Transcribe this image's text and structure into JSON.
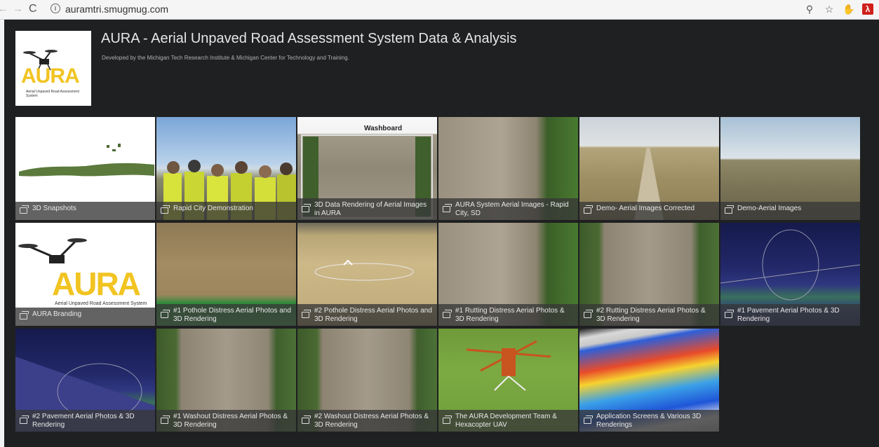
{
  "browser": {
    "url": "auramtri.smugmug.com"
  },
  "header": {
    "title": "AURA - Aerial Unpaved Road Assessment System Data & Analysis",
    "subtitle": "Developed by the Michigan Tech Research Institute & Michigan Center for Technology and Training."
  },
  "logo": {
    "text": "AURA",
    "tagline": "Aerial Unpaved Road Assessment System"
  },
  "galleries": [
    {
      "caption": "3D Snapshots"
    },
    {
      "caption": "Rapid City Demonstration"
    },
    {
      "caption": "3D Data Rendering of Aerial Images in AURA"
    },
    {
      "caption": "AURA System Aerial Images - Rapid City, SD"
    },
    {
      "caption": "Demo- Aerial Images Corrected"
    },
    {
      "caption": "Demo-Aerial Images"
    },
    {
      "caption": "AURA Branding"
    },
    {
      "caption": "#1 Pothole Distress Aerial Photos and 3D Rendering"
    },
    {
      "caption": "#2 Pothole Distress Aerial Photos and 3D Rendering"
    },
    {
      "caption": "#1 Rutting Distress Aerial Photos & 3D Rendering"
    },
    {
      "caption": "#2 Rutting Distress Aerial Photos & 3D Rendering"
    },
    {
      "caption": "#1 Pavement Aerial Photos & 3D Rendering"
    },
    {
      "caption": "#2 Pavement Aerial Photos & 3D Rendering"
    },
    {
      "caption": "#1 Washout Distress Aerial Photos & 3D Rendering"
    },
    {
      "caption": "#2 Washout Distress Aerial Photos & 3D Rendering"
    },
    {
      "caption": "The AURA Development Team & Hexacopter UAV"
    },
    {
      "caption": "Application Screens & Various 3D Renderings"
    }
  ],
  "washboard_label": "Washboard",
  "branding_tile": {
    "text": "AURA",
    "tagline": "Aerial Unpaved Road Assessment System"
  }
}
